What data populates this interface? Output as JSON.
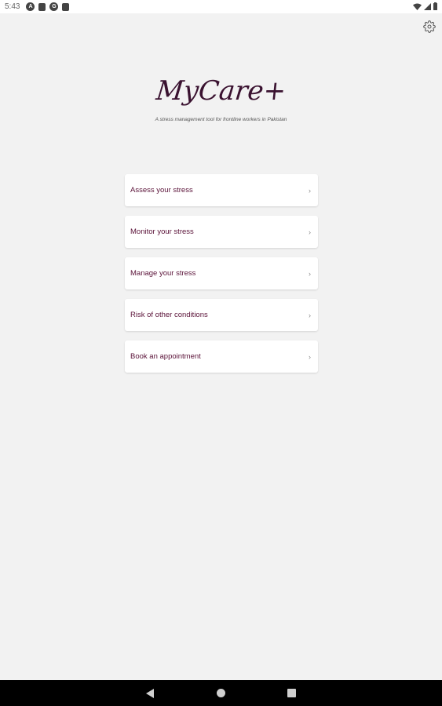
{
  "status_bar": {
    "time": "5:43",
    "notification_icons": [
      "a-icon",
      "square-notification-icon",
      "g-icon",
      "sim-card-icon"
    ],
    "right_icons": [
      "wifi-icon",
      "signal-icon",
      "battery-icon"
    ]
  },
  "app": {
    "logo": "MyCare+",
    "tagline": "A stress management tool for frontline workers in Pakistan"
  },
  "menu": {
    "items": [
      {
        "label": "Assess your stress",
        "chevron": "›"
      },
      {
        "label": "Monitor your stress",
        "chevron": "›"
      },
      {
        "label": "Manage your stress",
        "chevron": "›"
      },
      {
        "label": "Risk of other conditions",
        "chevron": "›"
      },
      {
        "label": "Book an appointment",
        "chevron": "›"
      }
    ]
  },
  "nav_bar": {
    "buttons": [
      "back",
      "home",
      "recents"
    ]
  },
  "colors": {
    "background": "#f2f2f2",
    "accent": "#5a1238",
    "logo": "#3a1230"
  }
}
